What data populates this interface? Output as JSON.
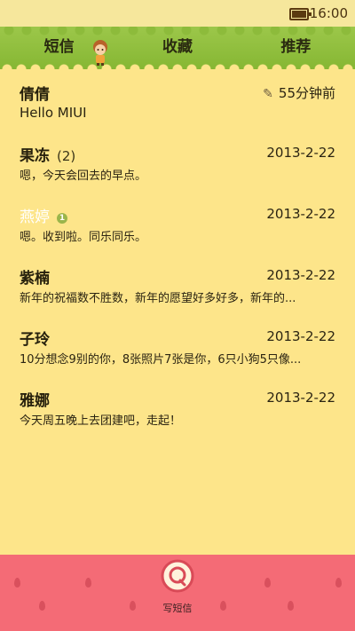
{
  "status_bar": {
    "time": "16:00",
    "battery_icon": "battery-icon"
  },
  "tabs": [
    {
      "label": "短信"
    },
    {
      "label": "收藏"
    },
    {
      "label": "推荐"
    }
  ],
  "conversations": [
    {
      "name": "倩倩",
      "count": "",
      "date": "55分钟前",
      "draft_icon": "pencil-icon",
      "preview": "Hello MIUI"
    },
    {
      "name": "果冻",
      "count": "(2)",
      "date": "2013-2-22",
      "preview": "嗯，今天会回去的早点。"
    },
    {
      "name": "燕婷",
      "count": "",
      "unread_badge": "1",
      "date": "2013-2-22",
      "preview": "嗯。收到啦。同乐同乐。"
    },
    {
      "name": "紫楠",
      "count": "",
      "date": "2013-2-22",
      "preview": "新年的祝福数不胜数，新年的愿望好多好多，新年的..."
    },
    {
      "name": "子玲",
      "count": "",
      "date": "2013-2-22",
      "preview": "10分想念9别的你，8张照片7张是你，6只小狗5只像..."
    },
    {
      "name": "雅娜",
      "count": "",
      "date": "2013-2-22",
      "preview": "今天周五晚上去团建吧，走起！"
    }
  ],
  "compose": {
    "label": "写短信",
    "icon": "compose-message-icon"
  },
  "colors": {
    "background": "#fde58a",
    "grass": "#8dbb3b",
    "bottom_bar": "#f46b76"
  }
}
